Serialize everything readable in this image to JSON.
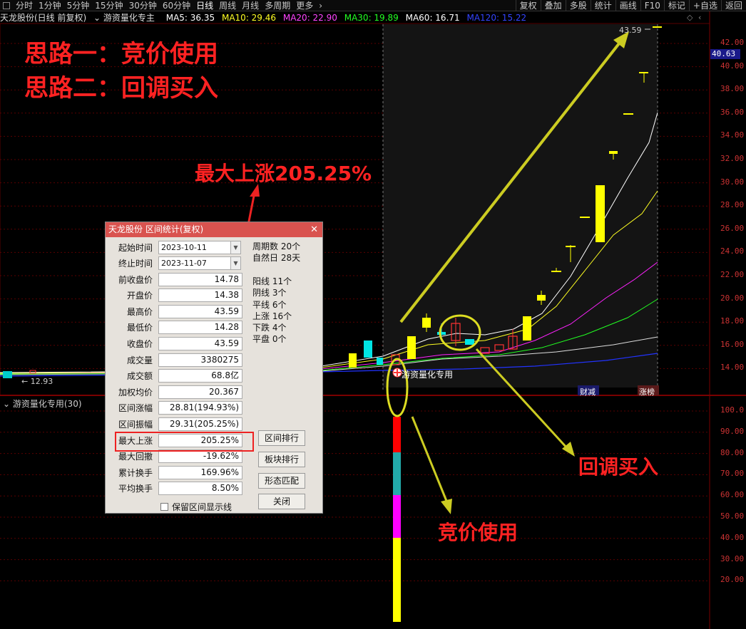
{
  "toolbar": {
    "left_items": [
      "分时",
      "1分钟",
      "5分钟",
      "15分钟",
      "30分钟",
      "60分钟",
      "日线",
      "周线",
      "月线",
      "多周期",
      "更多"
    ],
    "active_item": "日线",
    "right_items": [
      "复权",
      "叠加",
      "多股",
      "统计",
      "画线",
      "F10",
      "标记",
      "+自选",
      "返回"
    ]
  },
  "ma_row": {
    "stock_label": "天龙股份(日线 前复权)",
    "indicator_label": "游资量化专主",
    "ma5": "MA5: 36.35",
    "ma10": "MA10: 29.46",
    "ma20": "MA20: 22.90",
    "ma30": "MA30: 19.89",
    "ma60": "MA60: 16.71",
    "ma120": "MA120: 15.22"
  },
  "colors": {
    "ma5": "#ffffff",
    "ma10": "#ffff00",
    "ma20": "#ff00ff",
    "ma30": "#00ff00",
    "ma60": "#ffffff",
    "ma120": "#0000ff",
    "up": "#ff3333",
    "down": "#00ffff",
    "annotation": "#ff2222",
    "arrow": "#cccc22"
  },
  "price_axis": [
    "42.00",
    "40.00",
    "38.00",
    "36.00",
    "34.00",
    "32.00",
    "30.00",
    "28.00",
    "26.00",
    "24.00",
    "22.00",
    "20.00",
    "18.00",
    "16.00",
    "14.00"
  ],
  "current_price_tag": "40.63",
  "high_label": "43.59",
  "low_label": "12.93",
  "lower_panel_title": "游资量化专用(30)",
  "lower_axis": [
    "100.0",
    "90.00",
    "80.00",
    "70.00",
    "60.00",
    "50.00",
    "40.00",
    "30.00",
    "20.00"
  ],
  "chart_badges": {
    "left": "财减",
    "right": "涨榜"
  },
  "signal_label": "游资量化专用",
  "annotations": {
    "line1": "思路一：竞价使用",
    "line2": "思路二：回调买入",
    "max_rise": "最大上涨205.25%",
    "pullback": "回调买入",
    "auction": "竞价使用"
  },
  "dialog": {
    "title": "天龙股份 区间统计(复权)",
    "start_label": "起始时间",
    "start_value": "2023-10-11",
    "end_label": "终止时间",
    "end_value": "2023-11-07",
    "rows": [
      {
        "label": "前收盘价",
        "value": "14.78"
      },
      {
        "label": "开盘价",
        "value": "14.38"
      },
      {
        "label": "最高价",
        "value": "43.59"
      },
      {
        "label": "最低价",
        "value": "14.28"
      },
      {
        "label": "收盘价",
        "value": "43.59"
      },
      {
        "label": "成交量",
        "value": "3380275"
      },
      {
        "label": "成交额",
        "value": "68.8亿"
      },
      {
        "label": "加权均价",
        "value": "20.367"
      },
      {
        "label": "区间涨幅",
        "value": "28.81(194.93%)"
      },
      {
        "label": "区间振幅",
        "value": "29.31(205.25%)"
      },
      {
        "label": "最大上涨",
        "value": "205.25%"
      },
      {
        "label": "最大回撤",
        "value": "-19.62%"
      },
      {
        "label": "累计换手",
        "value": "169.96%"
      },
      {
        "label": "平均换手",
        "value": "8.50%"
      }
    ],
    "side_info": [
      "周期数 20个",
      "自然日 28天",
      "",
      "阳线 11个",
      "阴线 3个",
      "平线 6个",
      "上涨 16个",
      "下跌 4个",
      "平盘 0个"
    ],
    "buttons": [
      "区间排行",
      "板块排行",
      "形态匹配",
      "关闭"
    ],
    "checkbox_label": "保留区间显示线"
  }
}
